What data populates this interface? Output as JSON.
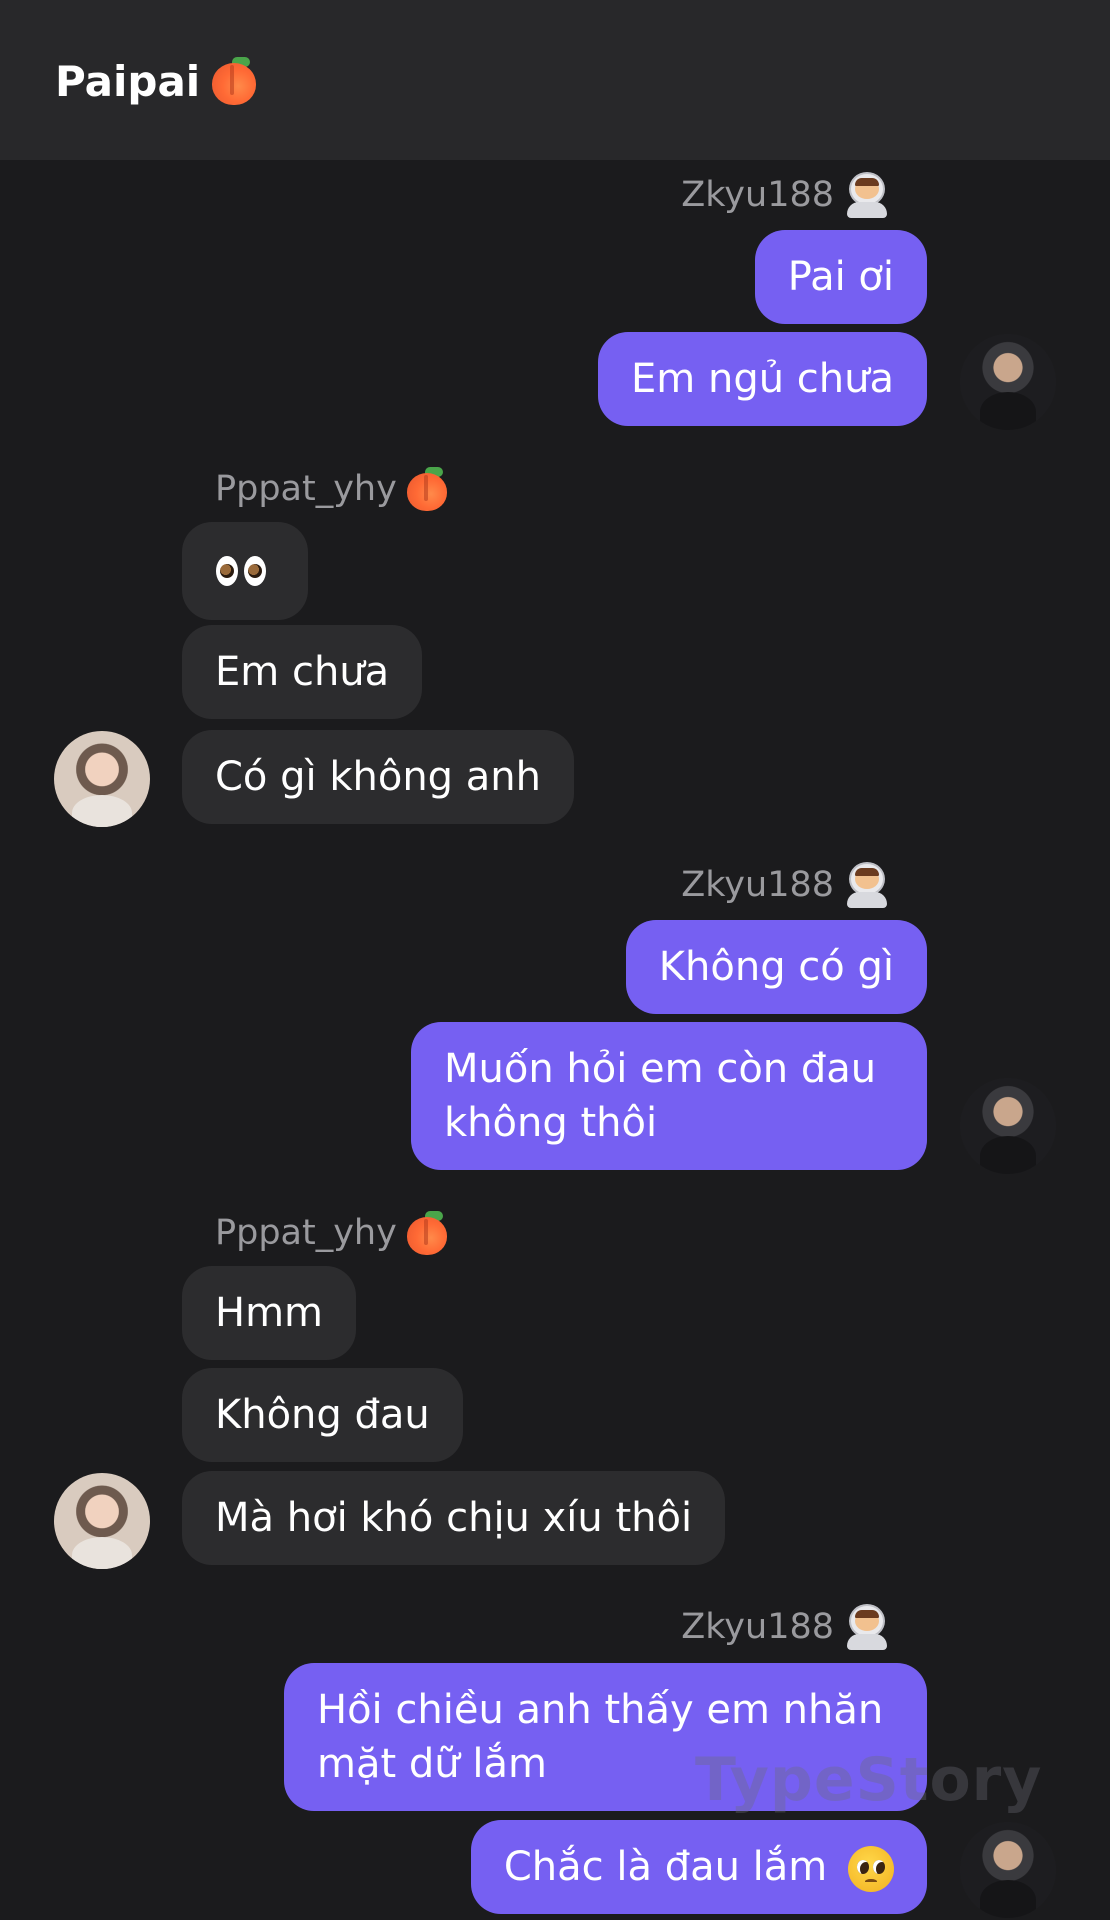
{
  "header": {
    "title": "Paipai",
    "emoji_icon": "peach-icon"
  },
  "colors": {
    "background": "#1b1b1d",
    "header": "#28282a",
    "my_bubble": "#7660f2",
    "their_bubble": "#2c2c2e",
    "sender_name": "#9a9a9e"
  },
  "users": {
    "me": {
      "name": "Zkyu188",
      "icon": "astronaut-icon"
    },
    "them": {
      "name": "Pppat_yhy",
      "icon": "peach-icon"
    }
  },
  "messages": {
    "g1": {
      "sender": "Zkyu188",
      "m1": "Pai ơi",
      "m2": "Em ngủ chưa"
    },
    "g2": {
      "sender": "Pppat_yhy",
      "m1_icon": "eyes-icon",
      "m2": "Em chưa",
      "m3": "Có gì không anh"
    },
    "g3": {
      "sender": "Zkyu188",
      "m1": "Không có gì",
      "m2_line1": "Muốn hỏi em còn đau",
      "m2_line2": "không thôi"
    },
    "g4": {
      "sender": "Pppat_yhy",
      "m1": "Hmm",
      "m2": "Không đau",
      "m3": "Mà hơi khó chịu xíu thôi"
    },
    "g5": {
      "sender": "Zkyu188",
      "m1_line1": "Hồi chiều anh thấy em nhăn",
      "m1_line2": "mặt dữ lắm",
      "m2": "Chắc là đau lắm",
      "m2_icon": "pleading-face-icon"
    }
  },
  "watermark": "TypeStory"
}
